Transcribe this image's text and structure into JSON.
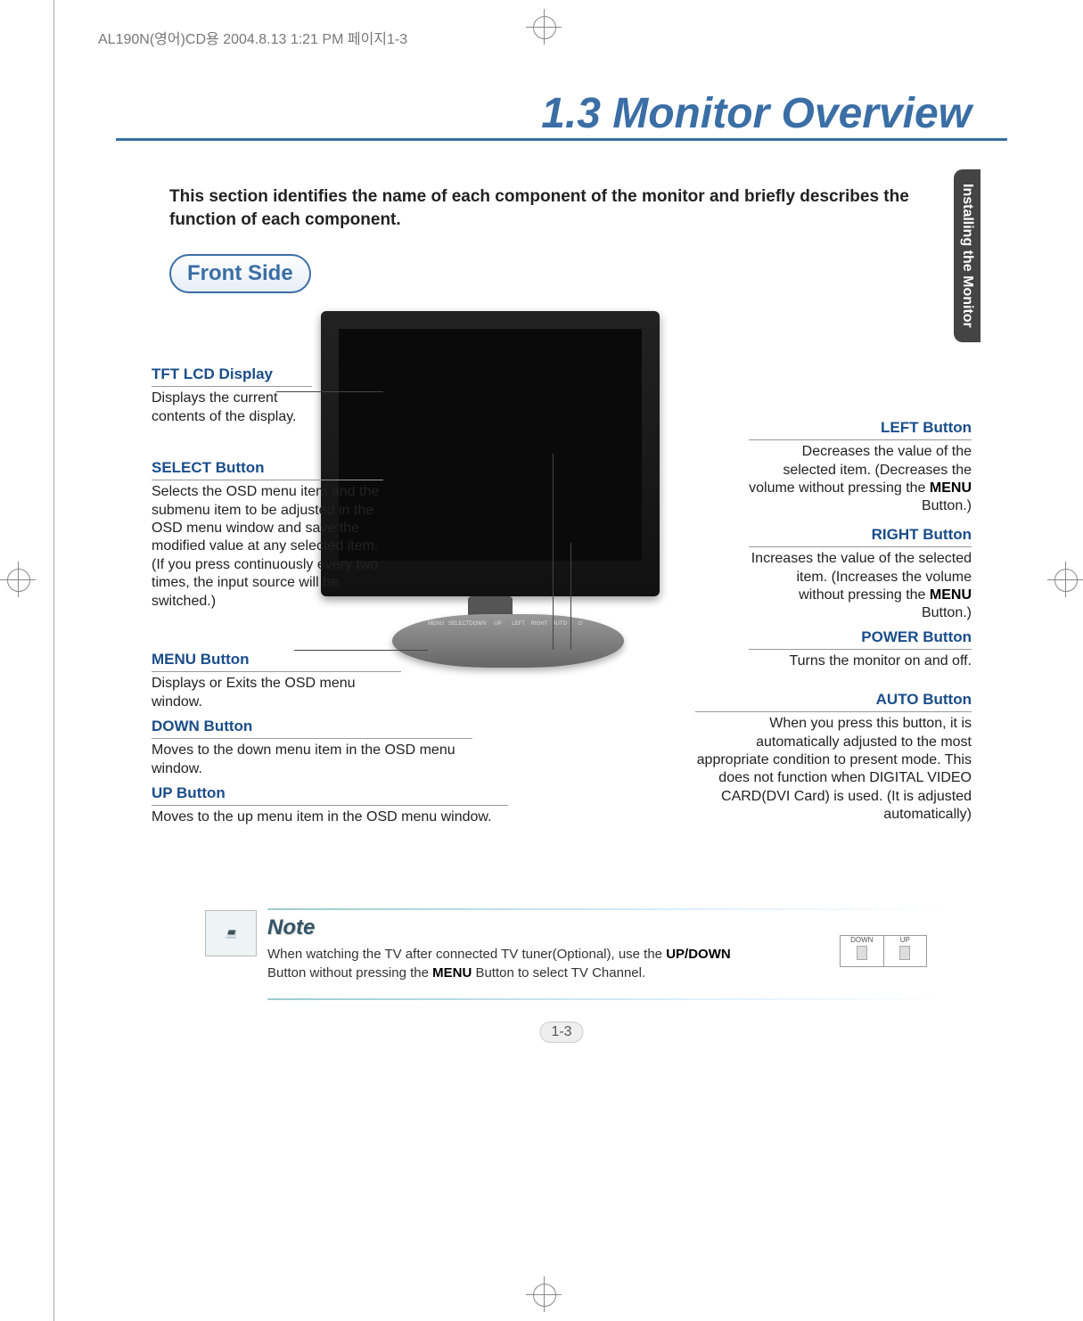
{
  "print_header": "AL190N(영어)CD용  2004.8.13 1:21 PM  페이지1-3",
  "title": "1.3  Monitor Overview",
  "side_tab": "Installing the Monitor",
  "intro": "This section identifies the name of each component of the monitor and briefly describes the function of each component.",
  "badge": "Front Side",
  "buttons_bar": [
    "MENU",
    "SELECT",
    "DOWN",
    "UP",
    "LEFT",
    "RIGHT",
    "AUTO",
    "⏻"
  ],
  "callouts": {
    "tft": {
      "h": "TFT LCD Display",
      "p": "Displays the current contents of the display."
    },
    "select": {
      "h": "SELECT Button",
      "p": "Selects the OSD menu item and the submenu item to be adjusted in the OSD menu window and save the modified value at any selected item. (If you press continuously every two times, the input source will be switched.)"
    },
    "menu": {
      "h": "MENU Button",
      "p": "Displays or Exits the OSD menu window."
    },
    "down": {
      "h": "DOWN Button",
      "p": "Moves to the down menu item in the OSD menu window."
    },
    "up": {
      "h": "UP Button",
      "p": "Moves to the up menu item in the OSD menu window."
    },
    "left": {
      "h": "LEFT Button",
      "p": "Decreases the value of the selected item. (Decreases the volume without pressing the ",
      "psuffix": " Button.)",
      "bold": "MENU"
    },
    "right": {
      "h": "RIGHT Button",
      "p": "Increases the value of the selected item. (Increases the volume without pressing the ",
      "psuffix": " Button.)",
      "bold": "MENU"
    },
    "power": {
      "h": "POWER Button",
      "p": "Turns the monitor on and off."
    },
    "auto": {
      "h": "AUTO Button",
      "p": "When you press this button, it is automatically adjusted to the most appropriate condition to present mode. This does not function when DIGITAL VIDEO CARD(DVI Card) is used. (It is adjusted automatically)"
    }
  },
  "note": {
    "heading": "Note",
    "body_pre": "When watching the TV after connected TV tuner(Optional), use the ",
    "bold1": "UP/DOWN",
    "body_mid": " Button without pressing the ",
    "bold2": "MENU",
    "body_post": " Button to select TV Channel.",
    "mini_labels": [
      "DOWN",
      "UP"
    ]
  },
  "page_number": "1-3"
}
